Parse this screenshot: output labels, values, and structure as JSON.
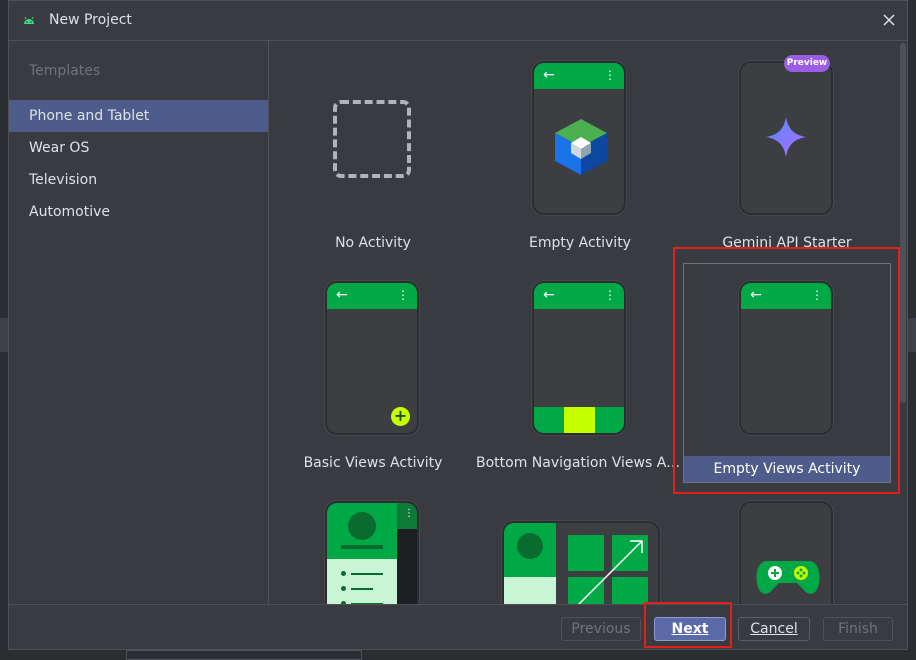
{
  "window": {
    "title": "New Project"
  },
  "sidebar": {
    "header": "Templates",
    "items": [
      {
        "label": "Phone and Tablet",
        "selected": true
      },
      {
        "label": "Wear OS",
        "selected": false
      },
      {
        "label": "Television",
        "selected": false
      },
      {
        "label": "Automotive",
        "selected": false
      }
    ]
  },
  "templates": [
    {
      "label": "No Activity"
    },
    {
      "label": "Empty Activity"
    },
    {
      "label": "Gemini API Starter",
      "badge": "Preview"
    },
    {
      "label": "Basic Views Activity"
    },
    {
      "label": "Bottom Navigation Views Activi..."
    },
    {
      "label": "Empty Views Activity",
      "selected": true
    }
  ],
  "footer": {
    "previous": "Previous",
    "next": "Next",
    "cancel": "Cancel",
    "finish": "Finish"
  },
  "colors": {
    "accent_green": "#00a846",
    "lime": "#c6ff00",
    "selection": "#4d5c8a",
    "highlight_red": "#e0201b",
    "preview_purple": "#9b5de5"
  }
}
